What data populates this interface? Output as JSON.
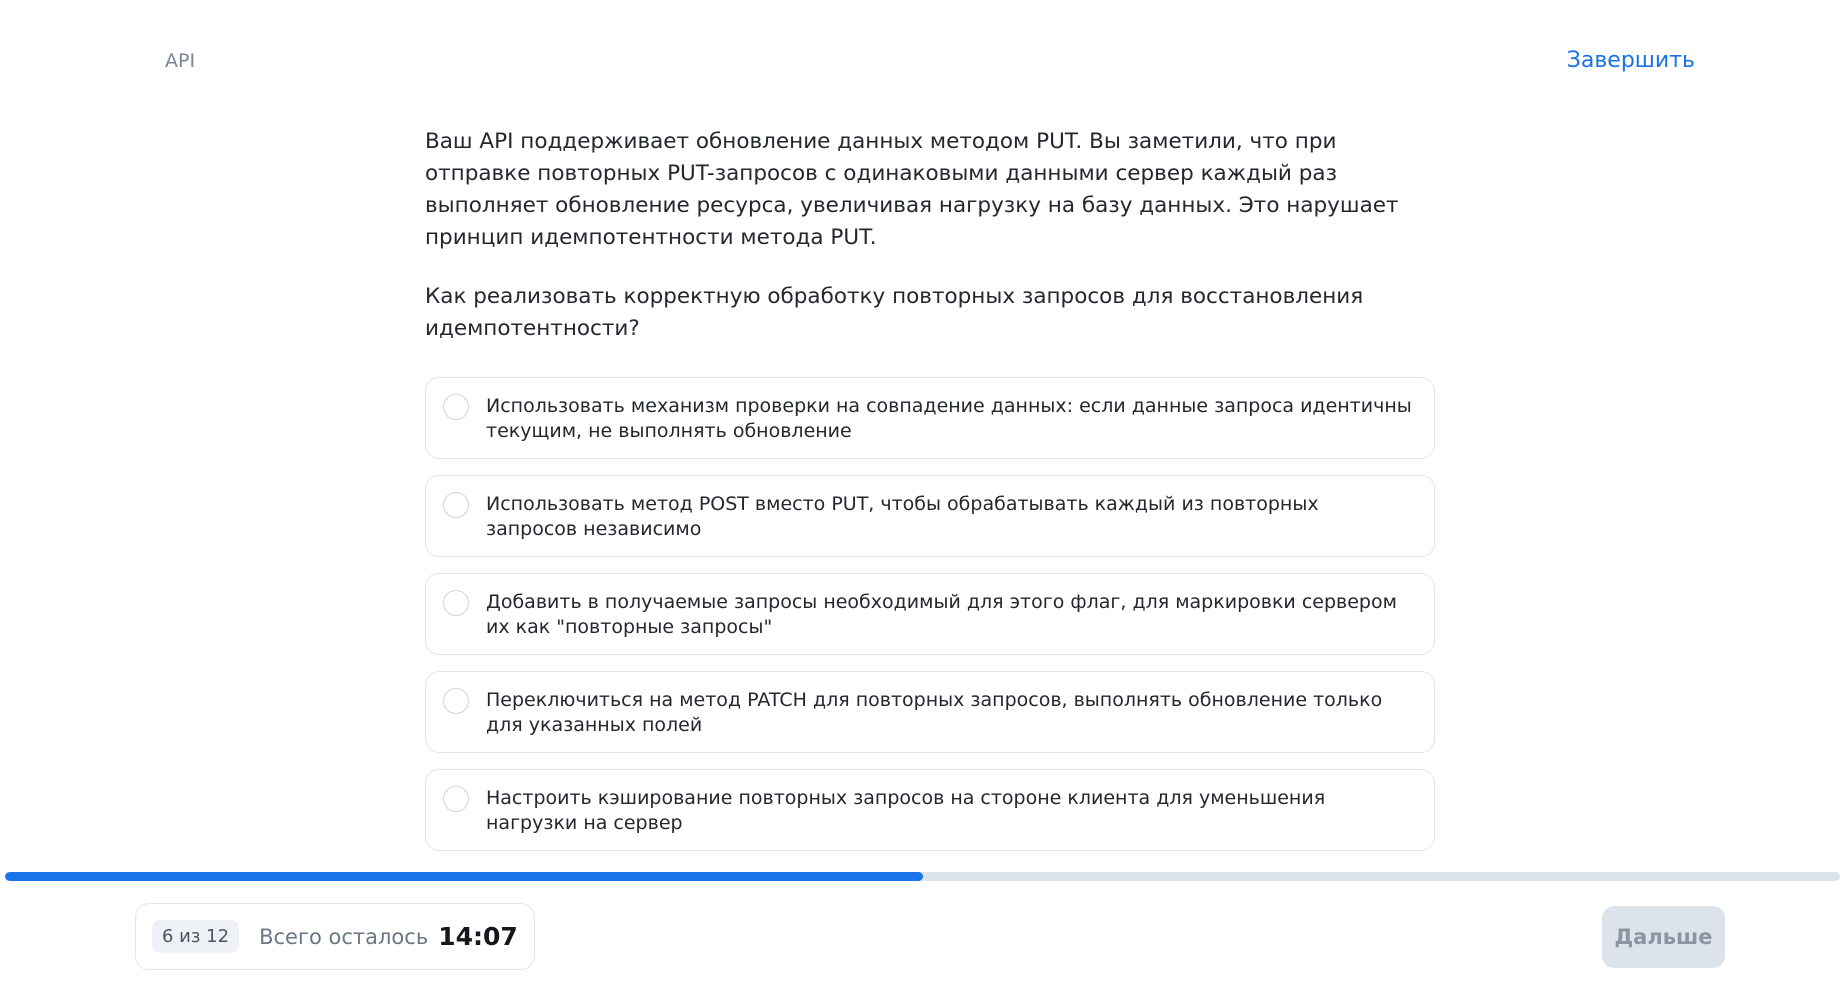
{
  "header": {
    "section": "API",
    "finish_label": "Завершить"
  },
  "question": {
    "text": "Ваш API поддерживает обновление данных методом PUT. Вы заметили, что при отправке повторных PUT-запросов с одинаковыми данными сервер каждый раз выполняет обновление ресурса, увеличивая нагрузку на базу данных. Это нарушает принцип идемпотентности метода PUT.",
    "prompt": "Как реализовать корректную обработку повторных запросов для восстановления идемпотентности?"
  },
  "options": [
    {
      "label": "Использовать механизм проверки на совпадение данных: если данные запроса идентичны текущим, не выполнять обновление"
    },
    {
      "label": "Использовать метод POST вместо PUT, чтобы обрабатывать каждый из повторных запросов независимо"
    },
    {
      "label": "Добавить в получаемые запросы необходимый для этого флаг, для маркировки сервером их как \"повторные запросы\""
    },
    {
      "label": "Переключиться на метод PATCH для повторных запросов, выполнять обновление только для указанных полей"
    },
    {
      "label": "Настроить кэширование повторных запросов на стороне клиента для уменьшения нагрузки на сервер"
    }
  ],
  "progress": {
    "fraction": 0.5
  },
  "footer": {
    "counter": "6 из 12",
    "time_left_label": "Всего осталось",
    "time_left_value": "14:07",
    "next_label": "Дальше"
  },
  "colors": {
    "accent": "#1a73e8",
    "track": "#dde3ea",
    "disabled_button": "#dde3ea"
  }
}
